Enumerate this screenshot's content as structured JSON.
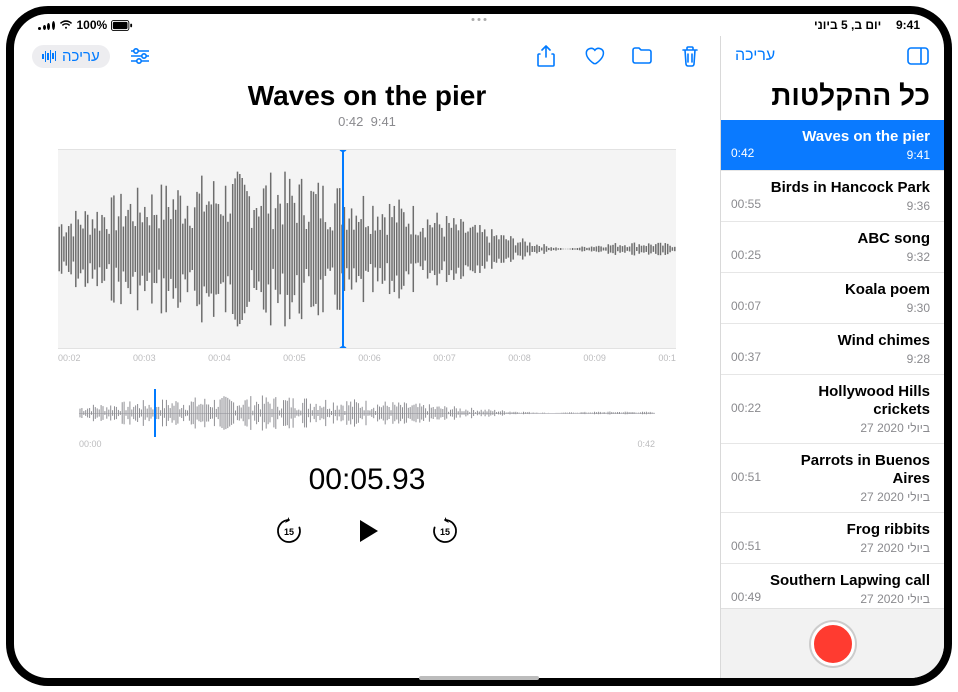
{
  "status": {
    "wifi": true,
    "battery_pct": "100%",
    "datetime": "יום ב, 5 ביוני",
    "time": "9:41"
  },
  "sidebar": {
    "edit_label": "עריכה",
    "title": "כל ההקלטות",
    "items": [
      {
        "title": "Waves on the pier",
        "sub": "9:41",
        "dur": "0:42",
        "selected": true
      },
      {
        "title": "Birds in Hancock Park",
        "sub": "9:36",
        "dur": "00:55"
      },
      {
        "title": "ABC song",
        "sub": "9:32",
        "dur": "00:25"
      },
      {
        "title": "Koala poem",
        "sub": "9:30",
        "dur": "00:07"
      },
      {
        "title": "Wind chimes",
        "sub": "9:28",
        "dur": "00:37"
      },
      {
        "title": "Hollywood Hills crickets",
        "sub": "27 ביולי 2020",
        "dur": "00:22"
      },
      {
        "title": "Parrots in Buenos Aires",
        "sub": "27 ביולי 2020",
        "dur": "00:51"
      },
      {
        "title": "Frog ribbits",
        "sub": "27 ביולי 2020",
        "dur": "00:51"
      },
      {
        "title": "Southern Lapwing call",
        "sub": "27 ביולי 2020",
        "dur": "00:49"
      }
    ]
  },
  "main": {
    "edit_pill_label": "עריכה",
    "title": "Waves on the pier",
    "meta_time": "9:41",
    "meta_dur": "0:42",
    "timecode": "00:05.93",
    "ruler_ticks": [
      "00:02",
      "00:03",
      "00:04",
      "00:05",
      "00:06",
      "00:07",
      "00:08",
      "00:09",
      "00:1"
    ],
    "overview_start": "00:00",
    "overview_end": "0:42"
  },
  "icons": {
    "sidebar_toggle": "sidebar-toggle-icon",
    "share": "share-icon",
    "favorite": "heart-icon",
    "folder": "folder-icon",
    "trash": "trash-icon",
    "options": "sliders-icon",
    "back15": "skip-back-15-icon",
    "play": "play-icon",
    "fwd15": "skip-forward-15-icon",
    "record": "record-icon"
  }
}
